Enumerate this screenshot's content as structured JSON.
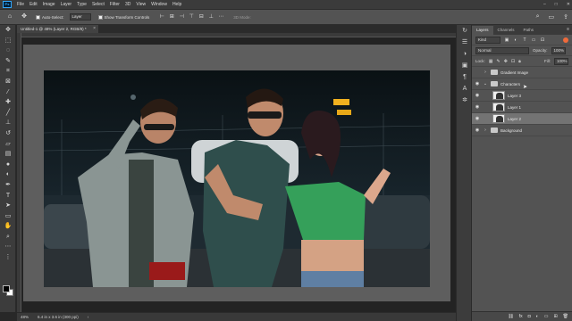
{
  "menu": [
    "File",
    "Edit",
    "Image",
    "Layer",
    "Type",
    "Select",
    "Filter",
    "3D",
    "View",
    "Window",
    "Help"
  ],
  "window_controls": [
    "–",
    "□",
    "✕"
  ],
  "options": {
    "auto_select_label": "Auto-Select:",
    "target_value": "Layer",
    "show_transform_label": "Show Transform Controls",
    "mode_3d_label": "3D Mode:"
  },
  "document": {
    "tab_title": "Untitled-1 @ 48% (Layer 2, RGB/8) *",
    "zoom": "48%",
    "doc_size": "6.4 in x 3.6 in (300 ppi)"
  },
  "panel": {
    "tabs": [
      "Layers",
      "Channels",
      "Paths"
    ],
    "active_tab": "Layers",
    "filter_kind": "Kind",
    "blend_mode": "Normal",
    "opacity_label": "Opacity:",
    "opacity_value": "100%",
    "lock_label": "Lock:",
    "fill_label": "Fill:",
    "fill_value": "100%"
  },
  "layers": [
    {
      "name": "Gradient Image",
      "type": "group",
      "expanded": false,
      "visible": false
    },
    {
      "name": "Characters",
      "type": "group",
      "expanded": true,
      "visible": true
    },
    {
      "name": "Layer 3",
      "type": "layer",
      "visible": true
    },
    {
      "name": "Layer 1",
      "type": "layer",
      "visible": true
    },
    {
      "name": "Layer 2",
      "type": "layer",
      "visible": true,
      "selected": true
    },
    {
      "name": "Background",
      "type": "group",
      "expanded": false,
      "visible": true
    }
  ],
  "colors": {
    "accent": "#31a8ff",
    "filter_toggle": "#f06a3b",
    "selected_layer": "#737373"
  },
  "icons": {
    "toolbar": [
      "move-icon",
      "marquee-icon",
      "lasso-icon",
      "quick-select-icon",
      "crop-icon",
      "frame-icon",
      "eyedropper-icon",
      "healing-icon",
      "brush-icon",
      "stamp-icon",
      "history-brush-icon",
      "eraser-icon",
      "gradient-icon",
      "blur-icon",
      "dodge-icon",
      "pen-icon",
      "type-icon",
      "path-select-icon",
      "shape-icon",
      "hand-icon",
      "zoom-icon",
      "more-tools-icon",
      "edit-toolbar-icon"
    ],
    "mini": [
      "history-icon",
      "properties-icon",
      "adjustments-icon",
      "libraries-icon",
      "paragraph-icon",
      "character-icon",
      "glyphs-icon"
    ]
  }
}
